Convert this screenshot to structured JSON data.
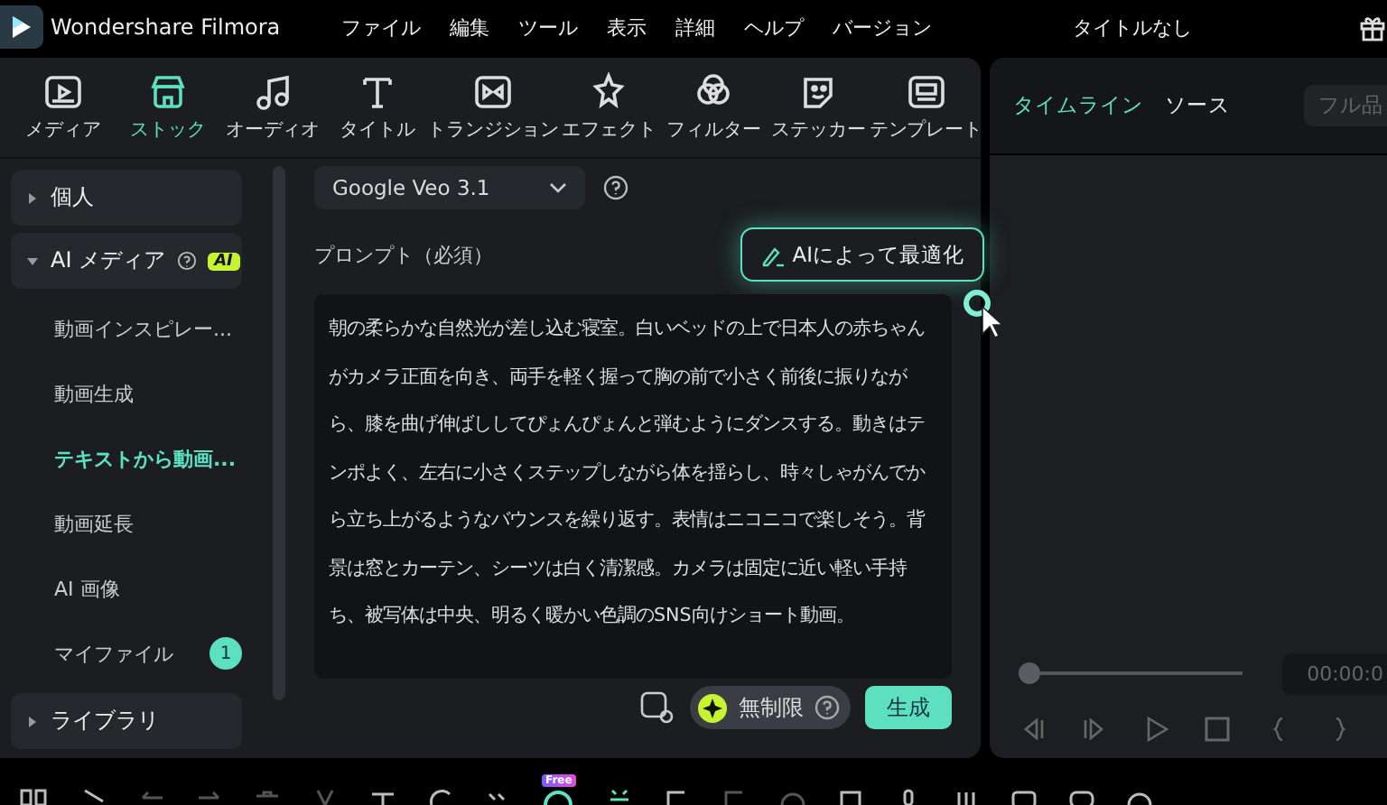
{
  "app": {
    "name": "Wondershare Filmora",
    "menus": [
      "ファイル",
      "編集",
      "ツール",
      "表示",
      "詳細",
      "ヘルプ",
      "バージョン"
    ],
    "project_title": "タイトルなし"
  },
  "media_tabs": [
    {
      "label": "メディア",
      "selected": false
    },
    {
      "label": "ストック",
      "selected": true
    },
    {
      "label": "オーディオ",
      "selected": false
    },
    {
      "label": "タイトル",
      "selected": false
    },
    {
      "label": "トランジション",
      "selected": false
    },
    {
      "label": "エフェクト",
      "selected": false
    },
    {
      "label": "フィルター",
      "selected": false
    },
    {
      "label": "ステッカー",
      "selected": false
    },
    {
      "label": "テンプレート",
      "selected": false
    }
  ],
  "sidebar": [
    {
      "label": "個人",
      "expanded": false
    },
    {
      "label": "AI メディア",
      "expanded": true,
      "badge": "AI",
      "children": [
        {
          "label": "動画インスピレー...",
          "selected": false
        },
        {
          "label": "動画生成",
          "selected": false
        },
        {
          "label": "テキストから動画...",
          "selected": true
        },
        {
          "label": "動画延長",
          "selected": false
        },
        {
          "label": "AI 画像",
          "selected": false
        },
        {
          "label": "マイファイル",
          "selected": false,
          "count": "1"
        }
      ]
    },
    {
      "label": "ライブラリ",
      "expanded": false
    }
  ],
  "generator": {
    "model": "Google Veo 3.1",
    "prompt_label": "プロンプト（必須）",
    "optimize_button": "AIによって最適化",
    "prompt": "朝の柔らかな自然光が差し込む寝室。白いベッドの上で日本人の赤ちゃんがカメラ正面を向き、両手を軽く握って胸の前で小さく前後に振りながら、膝を曲げ伸ばししてぴょんぴょんと弾むようにダンスする。動きはテンポよく、左右に小さくステップしながら体を揺らし、時々しゃがんでから立ち上がるようなバウンスを繰り返す。表情はニコニコで楽しそう。背景は窓とカーテン、シーツは白く清潔感。カメラは固定に近い軽い手持ち、被写体は中央、明るく暖かい色調のSNS向けショート動画。",
    "credits": "無制限",
    "generate_button": "生成"
  },
  "preview": {
    "tabs": [
      {
        "label": "タイムライン",
        "selected": true
      },
      {
        "label": "ソース",
        "selected": false
      }
    ],
    "quality": "フル品",
    "level": 0.0,
    "timecode": "00:00:0"
  },
  "bottom_toolbar": {
    "badge": "Free"
  }
}
